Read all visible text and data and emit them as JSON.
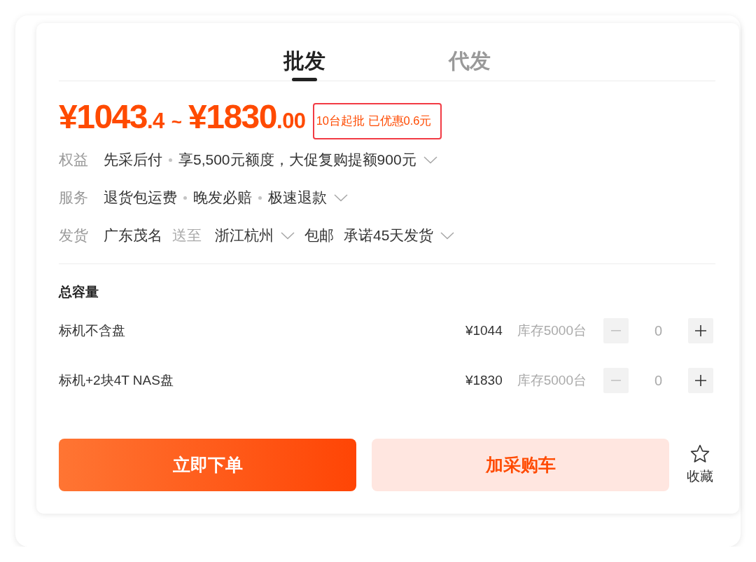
{
  "tabs": [
    {
      "label": "批发",
      "selected": true
    },
    {
      "label": "代发",
      "selected": false
    }
  ],
  "price": {
    "low": {
      "integer": "¥1043",
      "decimal": ".4"
    },
    "separator": "~",
    "high": {
      "integer": "¥1830",
      "decimal": ".00"
    },
    "note": "10台起批 已优惠0.6元"
  },
  "info_rows": [
    {
      "label": "权益",
      "segments": [
        {
          "kind": "text",
          "text": "先采后付"
        },
        {
          "kind": "dot"
        },
        {
          "kind": "text",
          "text": "享5,500元额度，大促复购提额900元"
        },
        {
          "kind": "chevron"
        }
      ]
    },
    {
      "label": "服务",
      "segments": [
        {
          "kind": "text",
          "text": "退货包运费"
        },
        {
          "kind": "dot"
        },
        {
          "kind": "text",
          "text": "晚发必赔"
        },
        {
          "kind": "dot"
        },
        {
          "kind": "text",
          "text": "极速退款"
        },
        {
          "kind": "chevron"
        }
      ]
    },
    {
      "label": "发货",
      "segments": [
        {
          "kind": "text",
          "text": "广东茂名"
        },
        {
          "kind": "muted",
          "text": "送至"
        },
        {
          "kind": "text",
          "text": "浙江杭州"
        },
        {
          "kind": "chevron"
        },
        {
          "kind": "text",
          "text": "包邮"
        },
        {
          "kind": "text",
          "text": "承诺45天发货"
        },
        {
          "kind": "chevron"
        }
      ]
    }
  ],
  "options": {
    "title": "总容量",
    "variants": [
      {
        "name": "标机不含盘",
        "price": "¥1044",
        "stock": "库存5000台",
        "quantity": "0",
        "decrease": {
          "disabled": true
        },
        "increase": {
          "disabled": false
        }
      },
      {
        "name": "标机+2块4T NAS盘",
        "price": "¥1830",
        "stock": "库存5000台",
        "quantity": "0",
        "decrease": {
          "disabled": true
        },
        "increase": {
          "disabled": false
        }
      }
    ]
  },
  "actions": {
    "buy": "立即下单",
    "cart": "加采购车",
    "favorite": "收藏"
  }
}
